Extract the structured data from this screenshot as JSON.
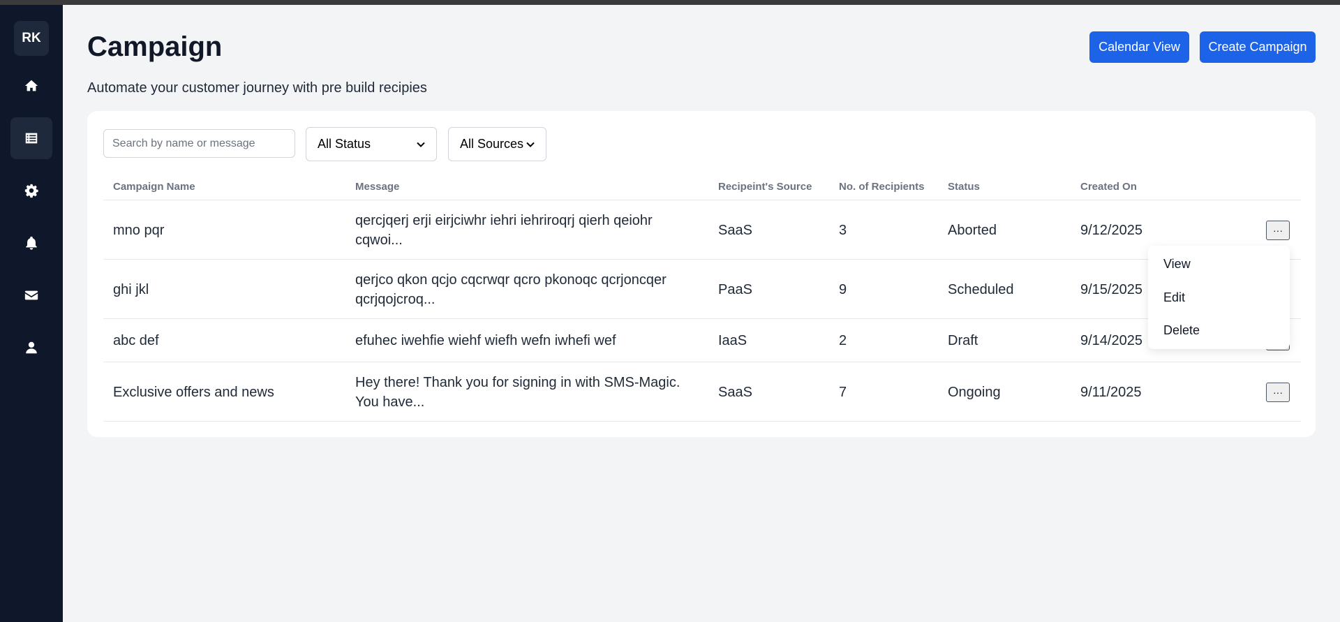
{
  "sidebar": {
    "avatar": "RK",
    "items": [
      {
        "icon": "home-icon"
      },
      {
        "icon": "list-icon",
        "active": true
      },
      {
        "icon": "gear-icon"
      },
      {
        "icon": "bell-icon"
      },
      {
        "icon": "mail-icon"
      },
      {
        "icon": "user-icon"
      }
    ]
  },
  "header": {
    "title": "Campaign",
    "subtitle": "Automate your customer journey with pre build recipies",
    "calendar_label": "Calendar View",
    "create_label": "Create Campaign"
  },
  "filters": {
    "search_placeholder": "Search by name or message",
    "status_selected": "All Status",
    "sources_selected": "All Sources"
  },
  "table": {
    "columns": [
      "Campaign Name",
      "Message",
      "Recipeint's Source",
      "No. of Recipients",
      "Status",
      "Created On"
    ],
    "rows": [
      {
        "name": "mno pqr",
        "message_line1": "qercjqerj erji eirjciwhr iehri iehriroqrj qierh qeiohr",
        "message_line2": "cqwoi...",
        "source": "SaaS",
        "recipients": "3",
        "status": "Aborted",
        "created": "9/12/2025"
      },
      {
        "name": "ghi jkl",
        "message_line1": "qerjco qkon qcjo cqcrwqr qcro pkonoqc qcrjoncqer",
        "message_line2": "qcrjqojcroq...",
        "source": "PaaS",
        "recipients": "9",
        "status": "Scheduled",
        "created": "9/15/2025"
      },
      {
        "name": "abc def",
        "message_line1": "efuhec iwehfie wiehf wiefh wefn iwhefi wef",
        "message_line2": "",
        "source": "IaaS",
        "recipients": "2",
        "status": "Draft",
        "created": "9/14/2025"
      },
      {
        "name": "Exclusive offers and news",
        "message_line1": "Hey there! Thank you for signing in with SMS-Magic.",
        "message_line2": "You have...",
        "source": "SaaS",
        "recipients": "7",
        "status": "Ongoing",
        "created": "9/11/2025"
      }
    ],
    "more_label": "···"
  },
  "menu": {
    "items": [
      "View",
      "Edit",
      "Delete"
    ]
  }
}
